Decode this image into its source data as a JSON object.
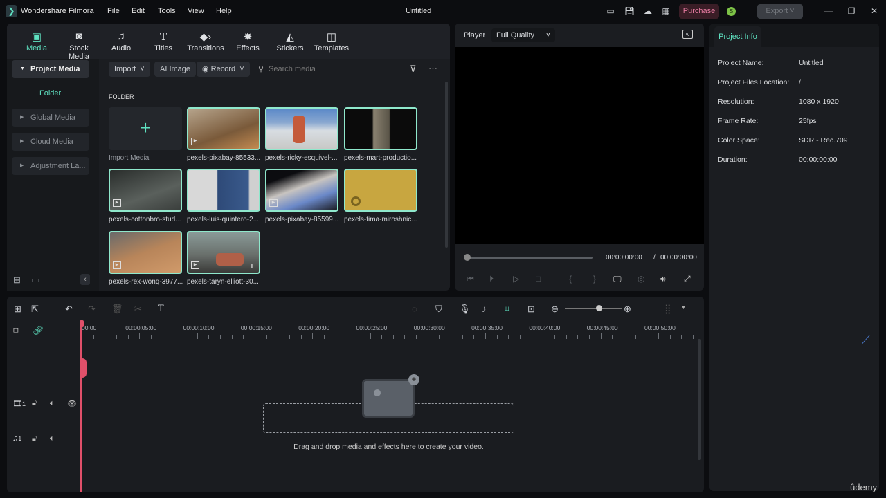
{
  "app": {
    "name": "Wondershare Filmora",
    "title": "Untitled",
    "menu": [
      "File",
      "Edit",
      "Tools",
      "View",
      "Help"
    ],
    "purchase": "Purchase",
    "coin": "S",
    "export": "Export"
  },
  "nav": [
    {
      "label": "Media",
      "icon": "media-icon"
    },
    {
      "label": "Stock Media",
      "icon": "stock-media-icon"
    },
    {
      "label": "Audio",
      "icon": "music-note-icon"
    },
    {
      "label": "Titles",
      "icon": "text-icon"
    },
    {
      "label": "Transitions",
      "icon": "transitions-icon"
    },
    {
      "label": "Effects",
      "icon": "effects-icon"
    },
    {
      "label": "Stickers",
      "icon": "stickers-icon"
    },
    {
      "label": "Templates",
      "icon": "templates-icon"
    }
  ],
  "sidebar": {
    "project_media": "Project Media",
    "folder": "Folder",
    "items": [
      "Global Media",
      "Cloud Media",
      "Adjustment La..."
    ]
  },
  "toolbar": {
    "import": "Import",
    "ai_image": "AI Image",
    "record": "Record",
    "search_placeholder": "Search media"
  },
  "media": {
    "folder_label": "FOLDER",
    "import_label": "Import Media",
    "items": [
      "pexels-pixabay-85533...",
      "pexels-ricky-esquivel-...",
      "pexels-mart-productio...",
      "pexels-cottonbro-stud...",
      "pexels-luis-quintero-2...",
      "pexels-pixabay-85599...",
      "pexels-tima-miroshnic...",
      "pexels-rex-wonq-3977...",
      "pexels-taryn-elliott-30..."
    ]
  },
  "player": {
    "label": "Player",
    "quality": "Full Quality",
    "current": "00:00:00:00",
    "separator": "/",
    "total": "00:00:00:00"
  },
  "project_info": {
    "tab": "Project Info",
    "rows": [
      {
        "label": "Project Name:",
        "value": "Untitled"
      },
      {
        "label": "Project Files Location:",
        "value": "/"
      },
      {
        "label": "Resolution:",
        "value": "1080 x 1920"
      },
      {
        "label": "Frame Rate:",
        "value": "25fps"
      },
      {
        "label": "Color Space:",
        "value": "SDR - Rec.709"
      },
      {
        "label": "Duration:",
        "value": "00:00:00:00"
      }
    ]
  },
  "timeline": {
    "ruler": [
      "00:00",
      "00:00:05:00",
      "00:00:10:00",
      "00:00:15:00",
      "00:00:20:00",
      "00:00:25:00",
      "00:00:30:00",
      "00:00:35:00",
      "00:00:40:00",
      "00:00:45:00",
      "00:00:50:00"
    ],
    "video_track": "1",
    "audio_track": "1",
    "drop_hint": "Drag and drop media and effects here to create your video.",
    "zoom_level": 0.6
  },
  "watermark": "ûdemy"
}
